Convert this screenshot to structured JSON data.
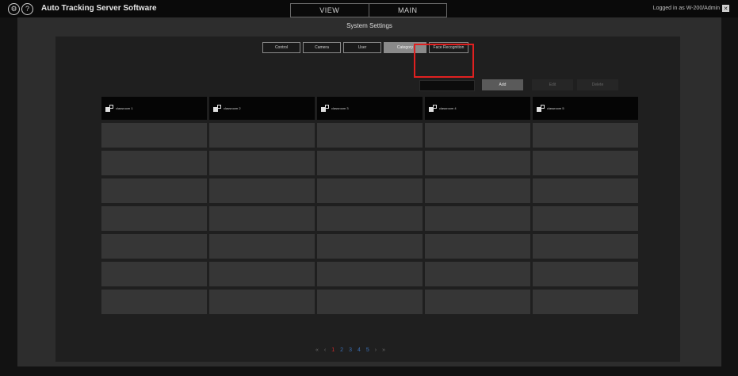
{
  "app": {
    "title": "Auto Tracking Server Software",
    "mode_tabs": [
      "VIEW",
      "MAIN"
    ],
    "login_status": "Logged in as W-200/Admin"
  },
  "settings": {
    "title": "System Settings",
    "tabs": [
      "Control",
      "Camera",
      "User",
      "Category",
      "Face Recognition"
    ],
    "active_tab": "Category",
    "buttons": {
      "add": "Add",
      "edit": "Edit",
      "delete": "Delete"
    },
    "search": {
      "value": "",
      "placeholder": ""
    }
  },
  "category_grid": {
    "headers": [
      "classroom 1",
      "classroom 2",
      "classroom 3",
      "classroom 4",
      "classroom 5"
    ],
    "empty_rows": 7
  },
  "pagination": {
    "first": "«",
    "prev": "‹",
    "pages": [
      "1",
      "2",
      "3",
      "4",
      "5"
    ],
    "current": "1",
    "next": "›",
    "last": "»"
  },
  "colors": {
    "highlight": "#e02020",
    "current_page": "#d02a2a",
    "page_link": "#3a6fb5"
  },
  "icons": [
    "settings-icon",
    "help-icon",
    "logout-icon",
    "camera-icon"
  ]
}
